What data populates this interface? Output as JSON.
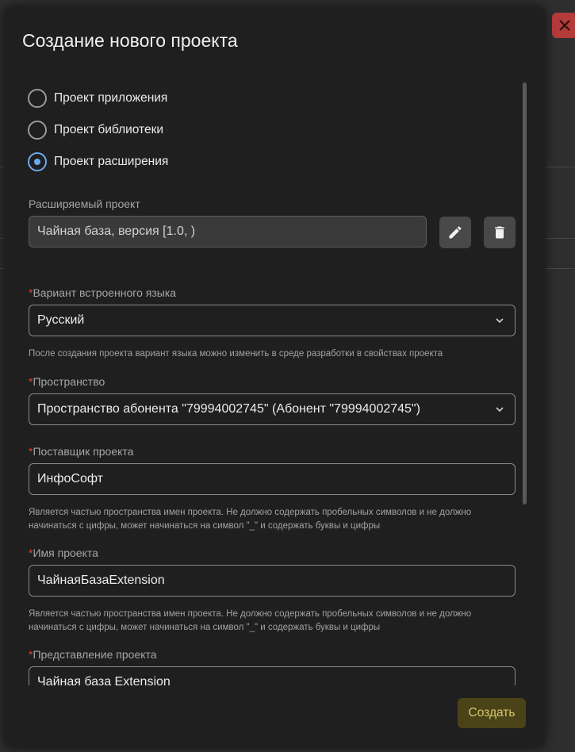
{
  "dialog": {
    "title": "Создание нового проекта",
    "project_types": [
      {
        "label": "Проект приложения",
        "checked": false
      },
      {
        "label": "Проект библиотеки",
        "checked": false
      },
      {
        "label": "Проект расширения",
        "checked": true
      }
    ],
    "extended_project": {
      "label": "Расширяемый проект",
      "value": "Чайная база, версия [1.0, )"
    },
    "language": {
      "label": "Вариант встроенного языка",
      "value": "Русский",
      "hint": "После создания проекта вариант языка можно изменить в среде разработки в свойствах проекта"
    },
    "space": {
      "label": "Пространство",
      "value": "Пространство абонента \"79994002745\" (Абонент \"79994002745\")"
    },
    "vendor": {
      "label": "Поставщик проекта",
      "value": "ИнфоСофт",
      "hint": "Является частью пространства имен проекта. Не должно содержать пробельных символов и не должно начинаться с цифры, может начинаться на символ \"_\" и содержать буквы и цифры"
    },
    "project_name": {
      "label": "Имя проекта",
      "value": "ЧайнаяБазаExtension",
      "hint": "Является частью пространства имен проекта. Не должно содержать пробельных символов и не должно начинаться с цифры, может начинаться на символ \"_\" и содержать буквы и цифры"
    },
    "project_view": {
      "label": "Представление проекта",
      "value": "Чайная база Extension"
    },
    "required_marker": "*",
    "create_label": "Создать"
  },
  "colors": {
    "accent_radio": "#6fa8f0",
    "required": "#e0443e",
    "create_bg": "#4a4318",
    "create_text": "#d6c86a",
    "close_bg": "#b53a3a"
  }
}
